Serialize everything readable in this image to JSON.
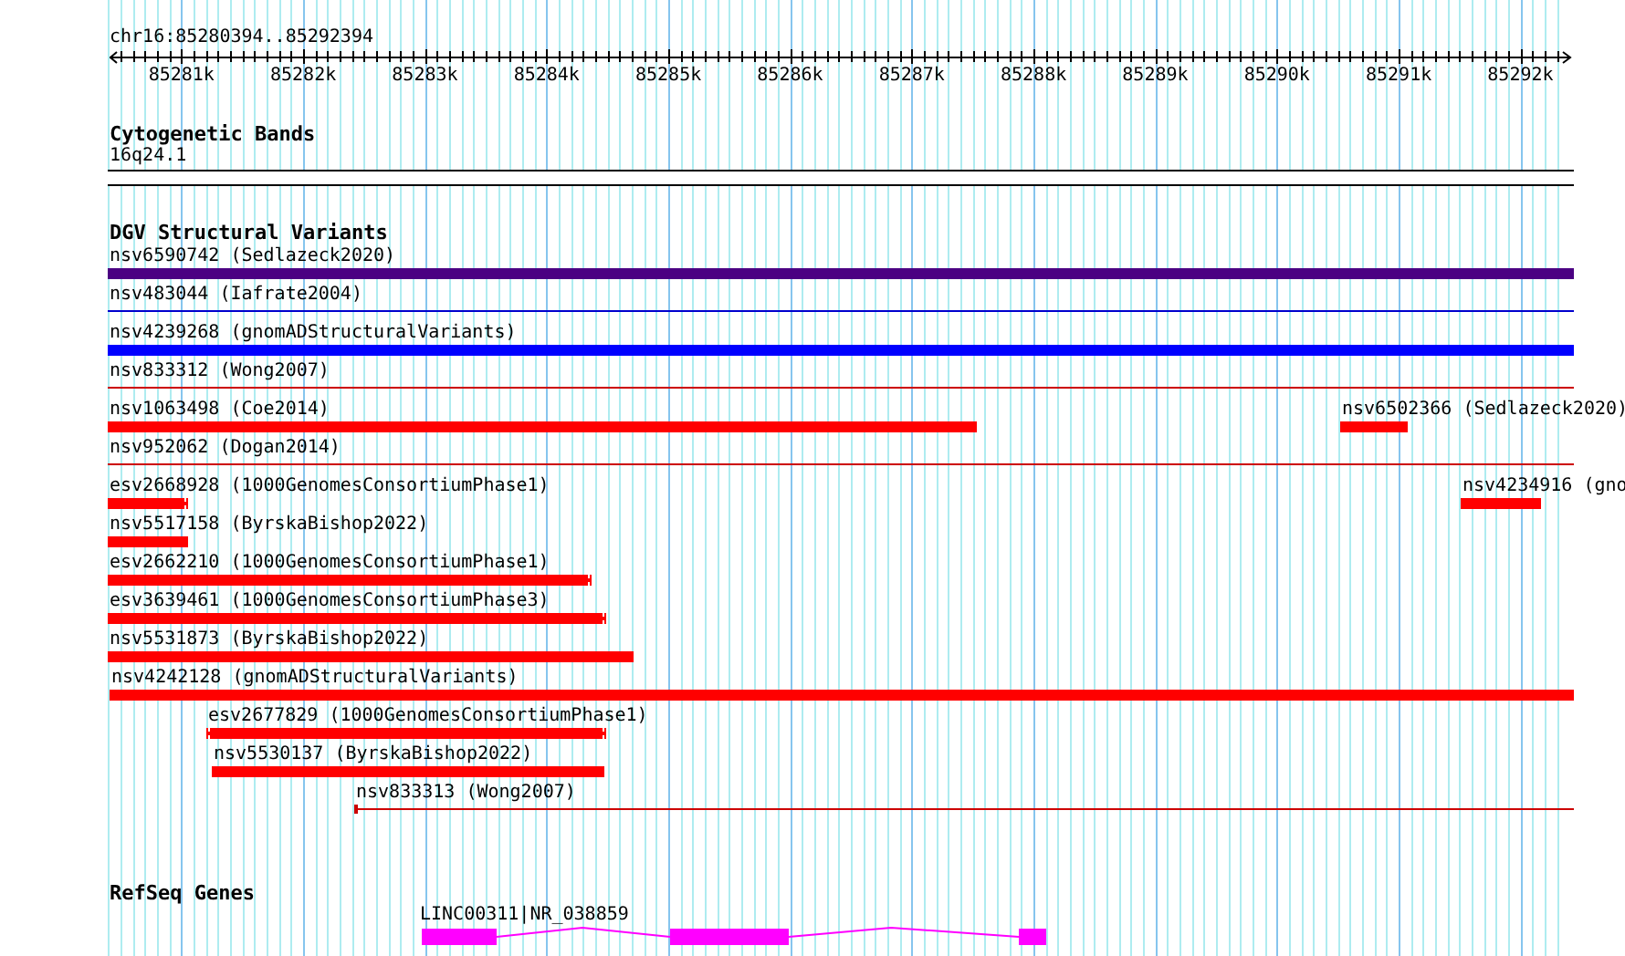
{
  "location": "chr16:85280394..85292394",
  "ruler": {
    "ticks": [
      "85281k",
      "85282k",
      "85283k",
      "85284k",
      "85285k",
      "85286k",
      "85287k",
      "85288k",
      "85289k",
      "85290k",
      "85291k",
      "85292k"
    ]
  },
  "cytogenetic_bands": {
    "title": "Cytogenetic Bands",
    "band": "16q24.1"
  },
  "dgv_structural_variants": {
    "title": "DGV Structural Variants",
    "rows": [
      {
        "features": [
          {
            "label": "nsv6590742 (Sedlazeck2020)",
            "kind": "bar",
            "color": "#4b0082"
          }
        ]
      },
      {
        "features": [
          {
            "label": "nsv483044 (Iafrate2004)",
            "kind": "line",
            "color": "#0000cd"
          }
        ]
      },
      {
        "features": [
          {
            "label": "nsv4239268 (gnomADStructuralVariants)",
            "kind": "bar",
            "color": "#0000ff"
          }
        ]
      },
      {
        "features": [
          {
            "label": "nsv833312 (Wong2007)",
            "kind": "line",
            "color": "#cc0000"
          }
        ]
      },
      {
        "features": [
          {
            "label": "nsv1063498 (Coe2014)",
            "kind": "bar",
            "color": "#ff0000"
          },
          {
            "label": "nsv6502366 (Sedlazeck2020)",
            "kind": "bar",
            "color": "#ff0000"
          }
        ]
      },
      {
        "features": [
          {
            "label": "nsv952062 (Dogan2014)",
            "kind": "line",
            "color": "#cc0000"
          }
        ]
      },
      {
        "features": [
          {
            "label": "esv2668928 (1000GenomesConsortiumPhase1)",
            "kind": "bar",
            "color": "#ff0000"
          },
          {
            "label": "nsv4234916 (gno",
            "kind": "bar",
            "color": "#ff0000"
          }
        ]
      },
      {
        "features": [
          {
            "label": "nsv5517158 (ByrskaBishop2022)",
            "kind": "bar",
            "color": "#ff0000"
          }
        ]
      },
      {
        "features": [
          {
            "label": "esv2662210 (1000GenomesConsortiumPhase1)",
            "kind": "bar",
            "color": "#ff0000"
          }
        ]
      },
      {
        "features": [
          {
            "label": "esv3639461 (1000GenomesConsortiumPhase3)",
            "kind": "bar",
            "color": "#ff0000"
          }
        ]
      },
      {
        "features": [
          {
            "label": "nsv5531873 (ByrskaBishop2022)",
            "kind": "bar",
            "color": "#ff0000"
          }
        ]
      },
      {
        "features": [
          {
            "label": "nsv4242128 (gnomADStructuralVariants)",
            "kind": "bar",
            "color": "#ff0000"
          }
        ]
      },
      {
        "features": [
          {
            "label": "esv2677829 (1000GenomesConsortiumPhase1)",
            "kind": "bar",
            "color": "#ff0000"
          }
        ]
      },
      {
        "features": [
          {
            "label": "nsv5530137 (ByrskaBishop2022)",
            "kind": "bar",
            "color": "#ff0000"
          }
        ]
      },
      {
        "features": [
          {
            "label": "nsv833313 (Wong2007)",
            "kind": "line",
            "color": "#cc0000"
          }
        ]
      }
    ]
  },
  "refseq_genes": {
    "title": "RefSeq Genes",
    "genes": [
      {
        "label": "LINC00311|NR_038859",
        "color": "#ff00ff"
      }
    ]
  }
}
